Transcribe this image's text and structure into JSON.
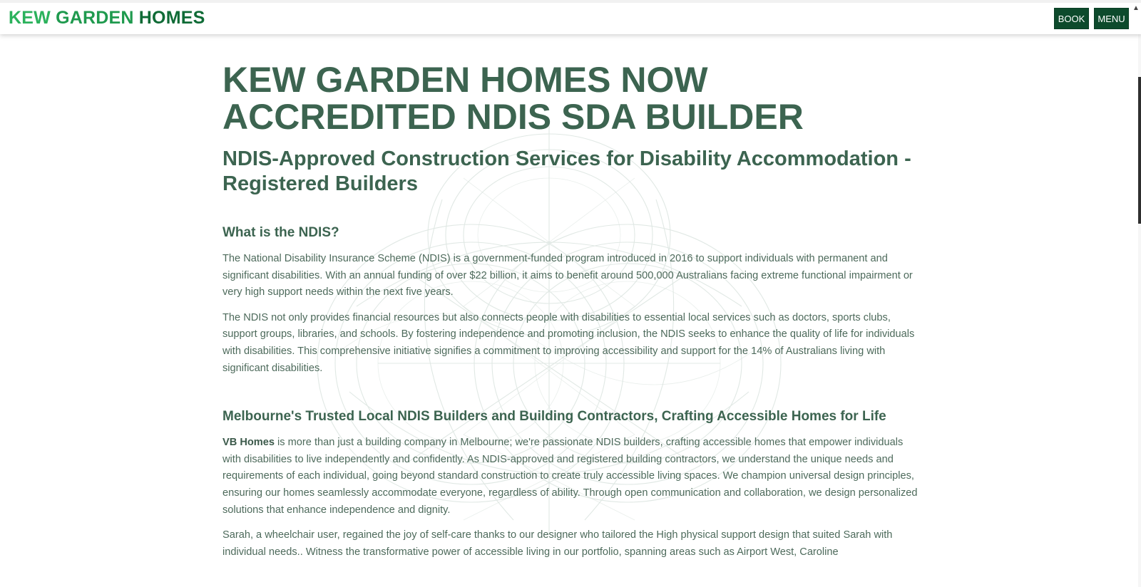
{
  "header": {
    "logo_words": [
      "KEW",
      "GARDEN",
      "HOMES"
    ],
    "book_label": "BOOK",
    "menu_label": "MENU"
  },
  "article": {
    "title": "KEW GARDEN HOMES NOW ACCREDITED NDIS SDA BUILDER",
    "subtitle": "NDIS-Approved Construction Services for Disability Accommodation - Registered Builders",
    "section1_heading": "What is the NDIS?",
    "section1_p1": "The National Disability Insurance Scheme (NDIS) is a government-funded program introduced in 2016 to support individuals with permanent and significant disabilities. With an annual funding of over $22 billion, it aims to benefit around 500,000 Australians facing extreme functional impairment or very high support needs within the next five years.",
    "section1_p2": "The NDIS not only provides financial resources but also connects people with disabilities to essential local services such as doctors, sports clubs, support groups, libraries, and schools. By fostering independence and promoting inclusion, the NDIS seeks to enhance the quality of life for individuals with disabilities. This comprehensive initiative signifies a commitment to improving accessibility and support for the 14% of Australians living with significant disabilities.",
    "section2_heading": "Melbourne's Trusted Local NDIS Builders and Building Contractors, Crafting Accessible Homes for Life",
    "section2_p1_bold": "VB Homes",
    "section2_p1_rest": " is more than just a building company in Melbourne; we're passionate NDIS builders, crafting accessible homes that empower individuals with disabilities to live independently and confidently. As NDIS-approved and registered building contractors, we understand the unique needs and requirements of each individual, going beyond standard construction to create truly accessible living spaces. We champion universal design principles, ensuring our homes seamlessly accommodate everyone, regardless of ability. Through open communication and collaboration, we design personalized solutions that enhance independence and dignity.",
    "section2_p2": "Sarah, a wheelchair user, regained the joy of self-care thanks to our designer who tailored the High physical support design that suited Sarah with individual needs.. Witness the transformative power of accessible living in our portfolio, spanning areas such as Airport West, Caroline"
  },
  "colors": {
    "heading": "#3c6450",
    "body_text": "#4d6a5b",
    "button_bg": "#0d4a2c",
    "logo_light": "#2bb25c",
    "logo_dark": "#0f6b36"
  },
  "icons": {
    "background": "knot-mesh-graphic"
  }
}
